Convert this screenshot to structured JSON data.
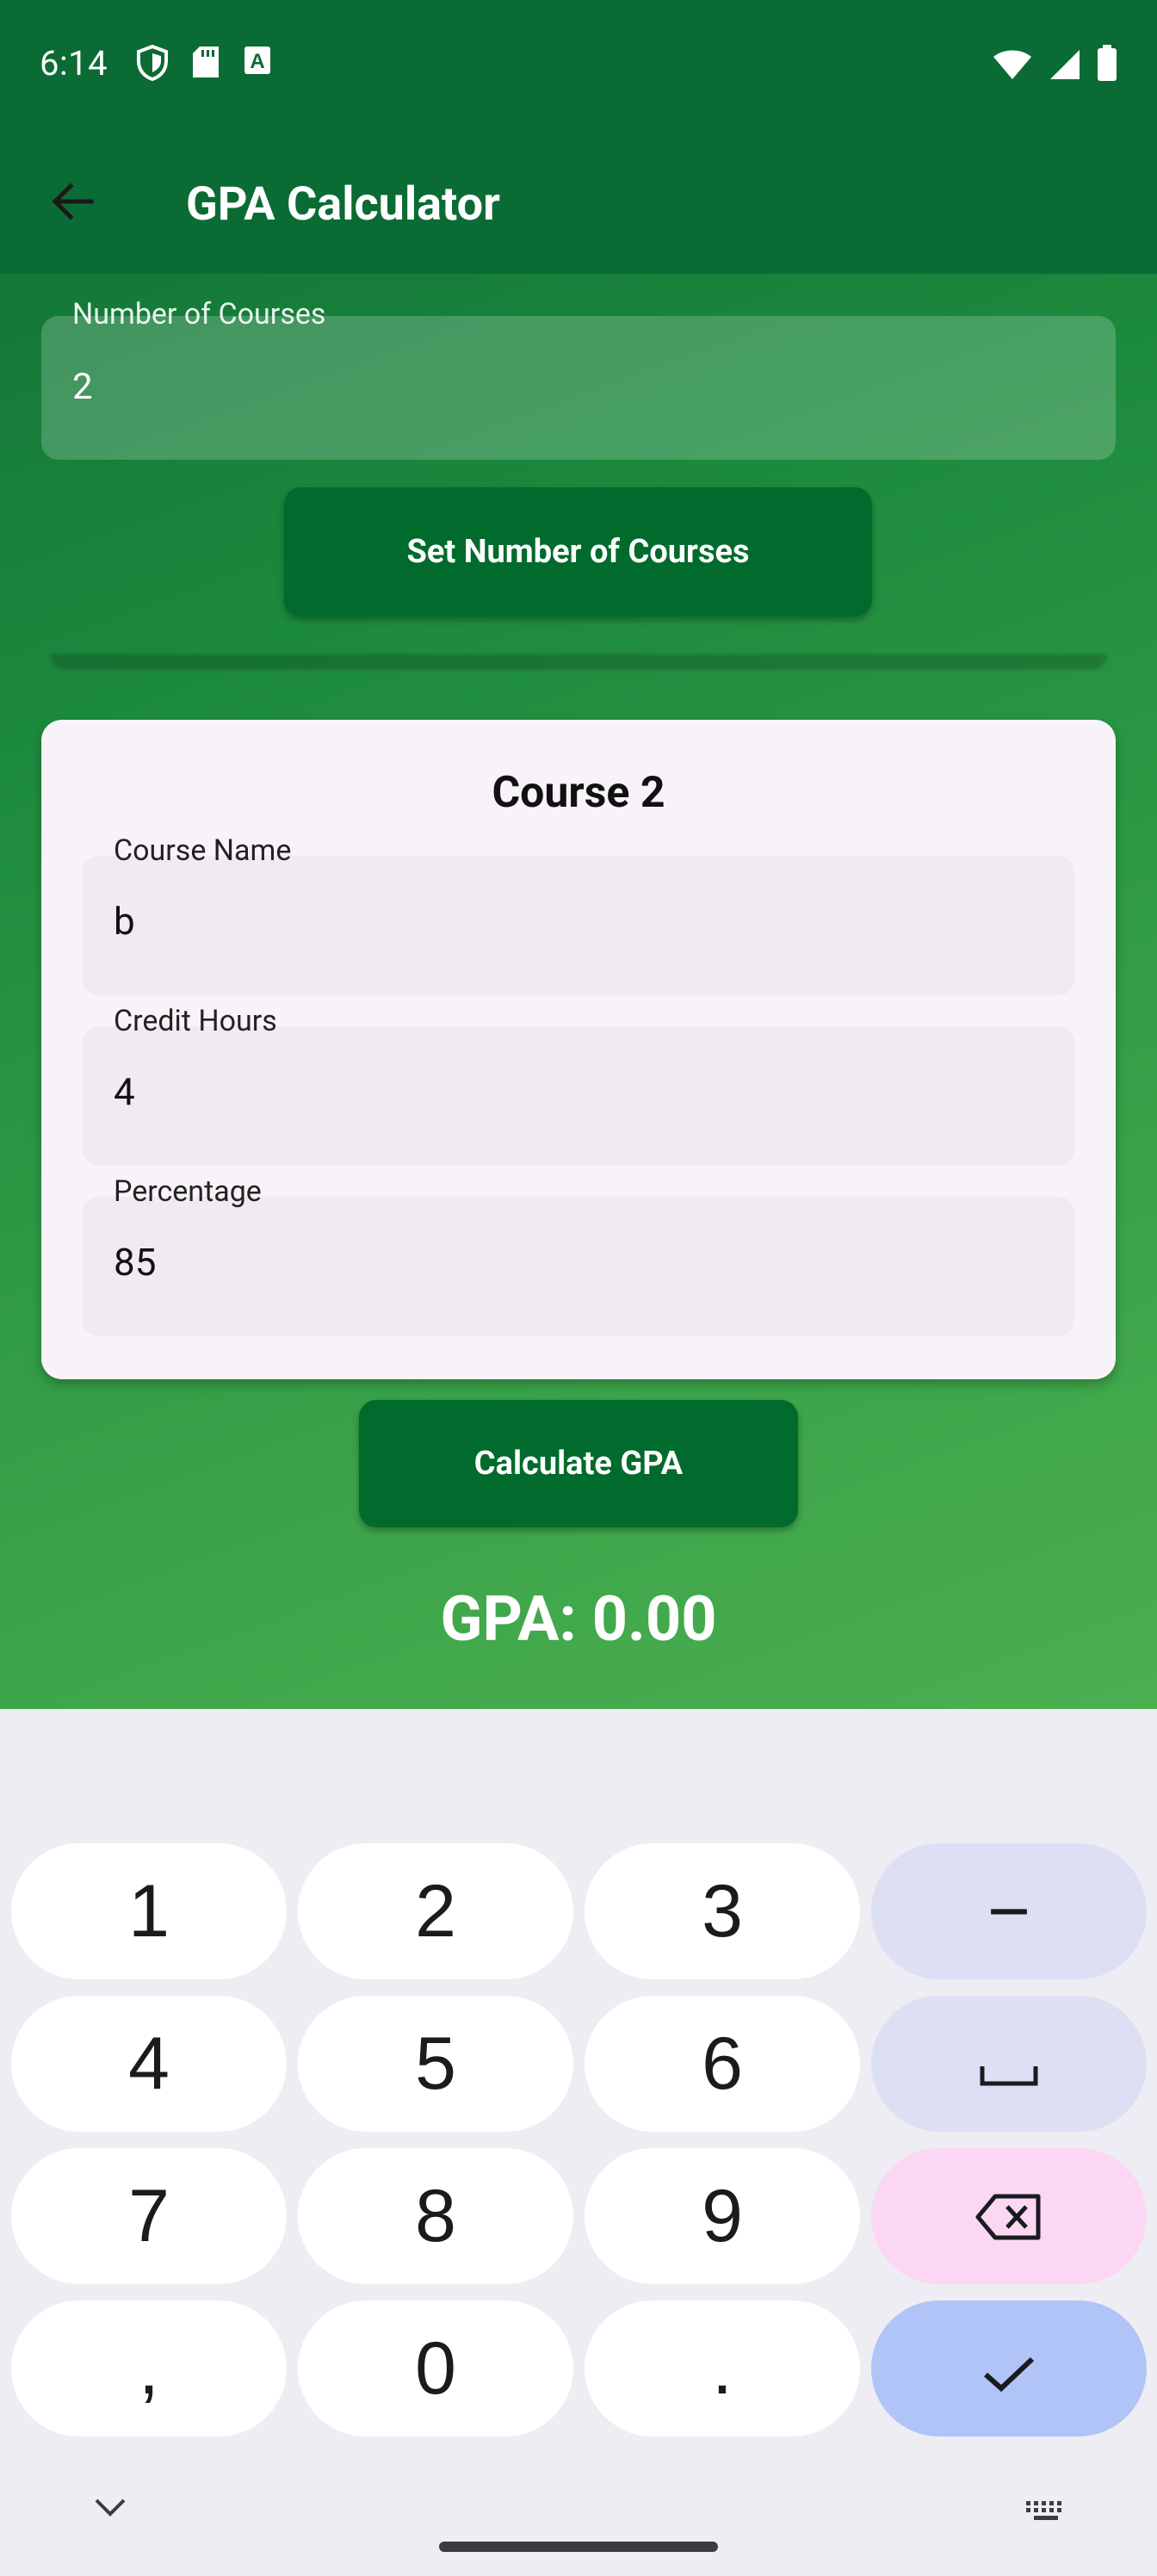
{
  "status_bar": {
    "time": "6:14",
    "left_icons": [
      "shield-icon",
      "sd-card-icon",
      "font-icon"
    ],
    "right_icons": [
      "wifi-icon",
      "signal-icon",
      "battery-icon"
    ]
  },
  "app_bar": {
    "back_icon": "arrow-back-icon",
    "title": "GPA Calculator"
  },
  "courses_input": {
    "label": "Number of Courses",
    "value": "2",
    "button_label": "Set Number of Courses"
  },
  "course_card": {
    "title": "Course 2",
    "fields": [
      {
        "label": "Course Name",
        "value": "b"
      },
      {
        "label": "Credit Hours",
        "value": "4"
      },
      {
        "label": "Percentage",
        "value": "85"
      }
    ]
  },
  "calculate_button_label": "Calculate GPA",
  "gpa_result": "GPA: 0.00",
  "keyboard": {
    "rows": [
      [
        "1",
        "2",
        "3",
        "−"
      ],
      [
        "4",
        "5",
        "6",
        "space-icon"
      ],
      [
        "7",
        "8",
        "9",
        "backspace-icon"
      ],
      [
        ",",
        "0",
        ".",
        "check-icon"
      ]
    ],
    "bottom_left_icon": "chevron-down-icon",
    "bottom_right_icon": "keyboard-icon"
  },
  "colors": {
    "app_bar": "#0b6b35",
    "button": "#006b2c",
    "gradient_end": "#4caf50",
    "card": "#f8f3f8"
  }
}
